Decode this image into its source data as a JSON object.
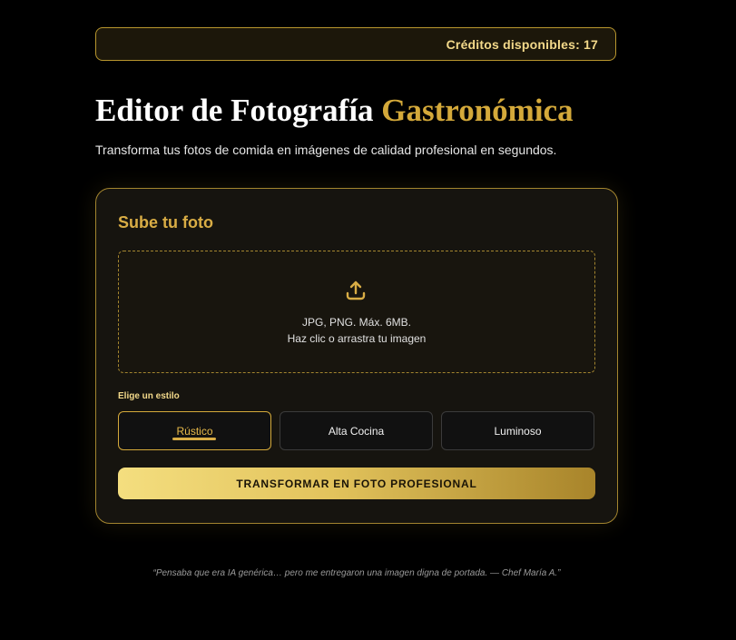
{
  "credits": {
    "text": "Créditos disponibles: 17"
  },
  "header": {
    "title_main": "Editor de Fotografía",
    "title_accent": "Gastronómica",
    "subtitle": "Transforma tus fotos de comida en imágenes de calidad profesional en segundos."
  },
  "upload": {
    "card_title": "Sube tu foto",
    "icon": "upload-icon",
    "formats": "JPG, PNG. Máx. 6MB.",
    "hint": "Haz clic o arrastra tu imagen"
  },
  "styles": {
    "label": "Elige un estilo",
    "options": [
      {
        "label": "Rústico",
        "selected": true
      },
      {
        "label": "Alta Cocina",
        "selected": false
      },
      {
        "label": "Luminoso",
        "selected": false
      }
    ]
  },
  "cta": {
    "label": "TRANSFORMAR EN FOTO PROFESIONAL"
  },
  "testimonial": {
    "text": "“Pensaba que era IA genérica… pero me entregaron una imagen digna de portada. — Chef María A.”"
  },
  "colors": {
    "background": "#000000",
    "accent_gold": "#d4a93a",
    "credits_text": "#f3d98a",
    "card_background": "#16140f"
  }
}
